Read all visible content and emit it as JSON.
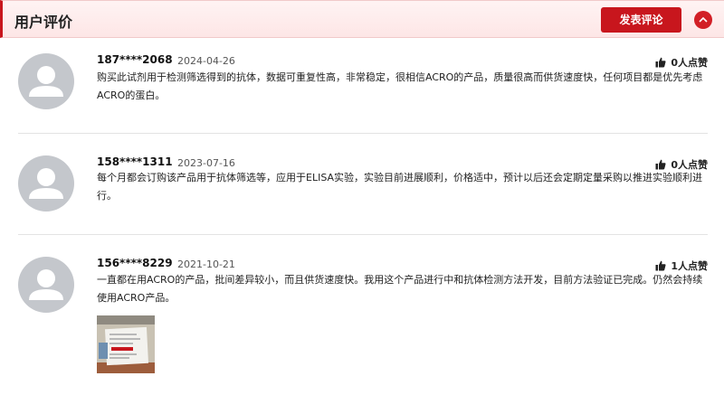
{
  "header": {
    "title": "用户评价",
    "post_button_label": "发表评论",
    "accent_color": "#c8161d"
  },
  "reviews": [
    {
      "user": "187****2068",
      "date": "2024-04-26",
      "likes": "0人点赞",
      "text": "购买此试剂用于检测筛选得到的抗体，数据可重复性高，非常稳定，很相信ACRO的产品，质量很高而供货速度快，任何项目都是优先考虑ACRO的蛋白。"
    },
    {
      "user": "158****1311",
      "date": "2023-07-16",
      "likes": "0人点赞",
      "text": "每个月都会订购该产品用于抗体筛选等，应用于ELISA实验，实验目前进展顺利，价格适中，预计以后还会定期定量采购以推进实验顺利进行。"
    },
    {
      "user": "156****8229",
      "date": "2021-10-21",
      "likes": "1人点赞",
      "text": "一直都在用ACRO的产品，批间差异较小，而且供货速度快。我用这个产品进行中和抗体检测方法开发，目前方法验证已完成。仍然会持续使用ACRO产品。",
      "has_image": true
    }
  ],
  "icons": {
    "collapse": "chevron-up-icon",
    "like": "thumbs-up-icon",
    "avatar": "default-user-avatar-icon"
  }
}
